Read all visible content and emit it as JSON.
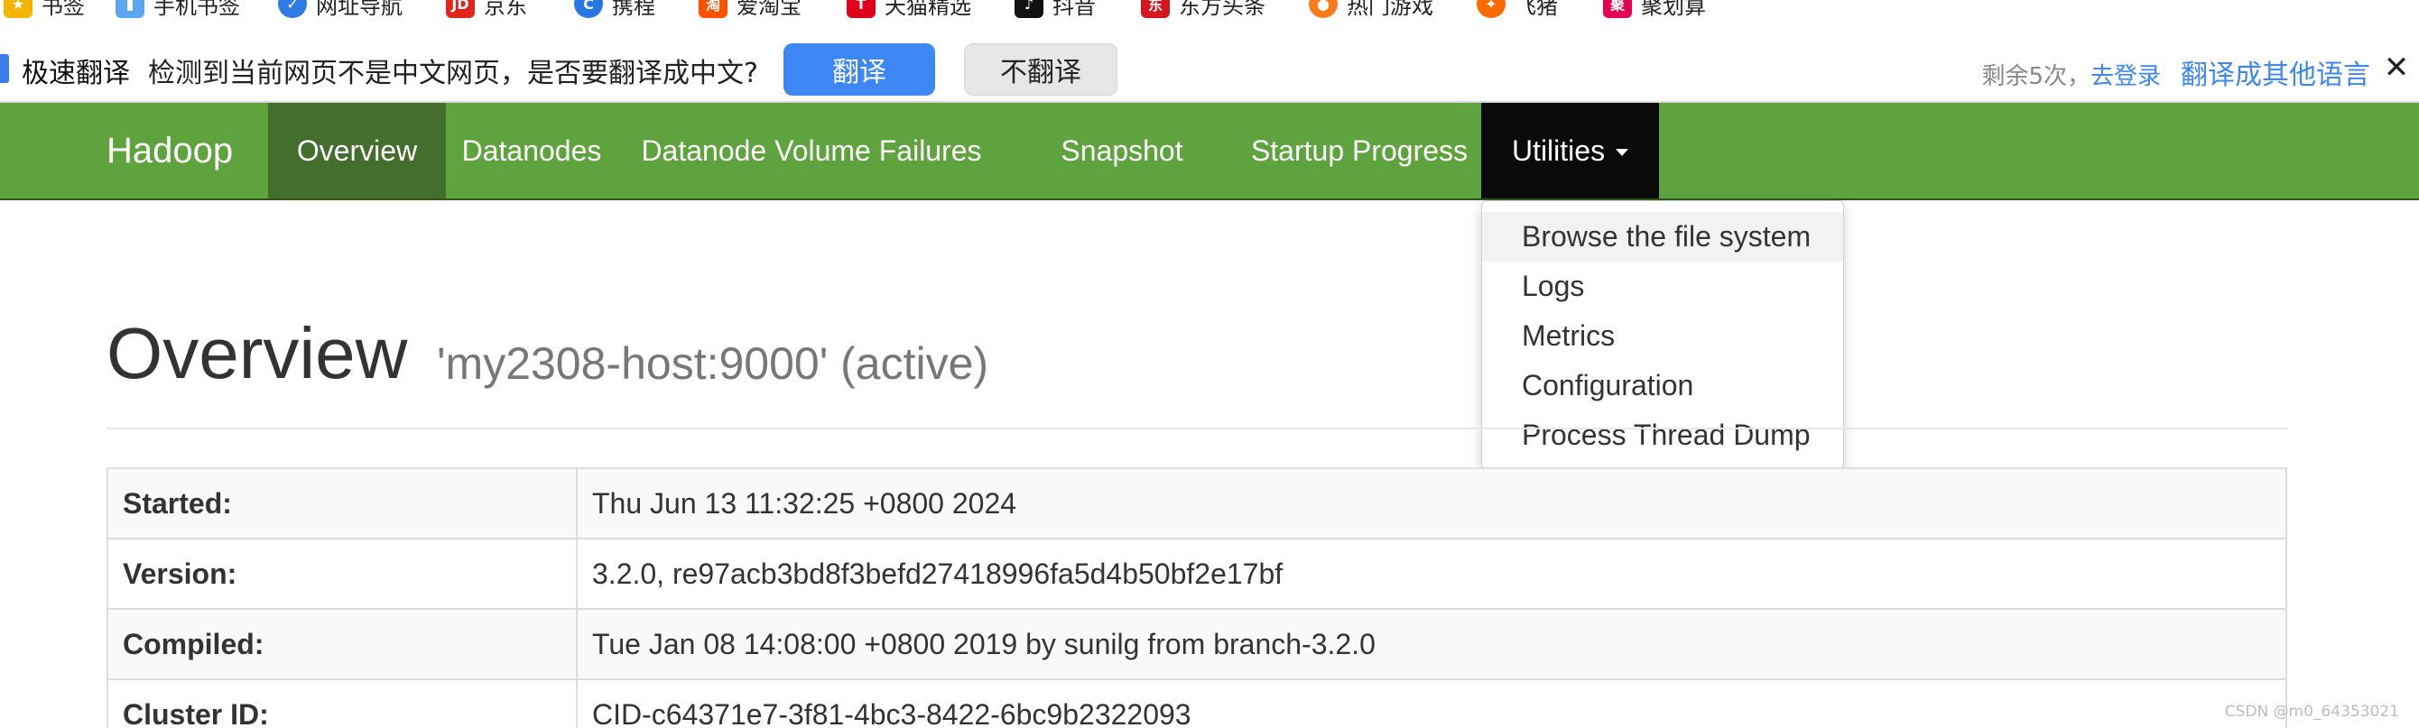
{
  "bookmarks": [
    {
      "label": "书签",
      "icon": "bookmark-star-icon",
      "color": "#f5b400"
    },
    {
      "label": "手机书签",
      "icon": "mobile-bookmark-icon",
      "color": "#5aa7f0"
    },
    {
      "label": "网址导航",
      "icon": "navigation-icon",
      "color": "#2f7be6"
    },
    {
      "label": "京东",
      "icon": "jd-logo-icon",
      "color": "#e1251b"
    },
    {
      "label": "携程",
      "icon": "ctrip-logo-icon",
      "color": "#2577e3"
    },
    {
      "label": "爱淘宝",
      "icon": "aitaobao-logo-icon",
      "color": "#ff5000"
    },
    {
      "label": "天猫精选",
      "icon": "tmall-logo-icon",
      "color": "#e0001b"
    },
    {
      "label": "抖音",
      "icon": "douyin-logo-icon",
      "color": "#111111"
    },
    {
      "label": "东方头条",
      "icon": "dongfang-logo-icon",
      "color": "#d4151b"
    },
    {
      "label": "热门游戏",
      "icon": "game-icon",
      "color": "#ff7a1a"
    },
    {
      "label": "飞猪",
      "icon": "fliggy-logo-icon",
      "color": "#ff6a00"
    },
    {
      "label": "聚划算",
      "icon": "juhuasuan-logo-icon",
      "color": "#e5004f"
    }
  ],
  "translate_bar": {
    "title": "极速翻译",
    "message": "检测到当前网页不是中文网页，是否要翻译成中文?",
    "translate_label": "翻译",
    "no_translate_label": "不翻译",
    "remaining": "剩余5次，",
    "login_label": "去登录",
    "other_lang_label": "翻译成其他语言",
    "close_glyph": "✕"
  },
  "navbar": {
    "brand": "Hadoop",
    "items": [
      {
        "label": "Overview",
        "state": "active"
      },
      {
        "label": "Datanodes",
        "state": "normal"
      },
      {
        "label": "Datanode Volume Failures",
        "state": "normal"
      },
      {
        "label": "Snapshot",
        "state": "normal"
      },
      {
        "label": "Startup Progress",
        "state": "normal"
      },
      {
        "label": "Utilities",
        "state": "open"
      }
    ]
  },
  "utilities_menu": [
    {
      "label": "Browse the file system",
      "hovered": true
    },
    {
      "label": "Logs",
      "hovered": false
    },
    {
      "label": "Metrics",
      "hovered": false
    },
    {
      "label": "Configuration",
      "hovered": false
    },
    {
      "label": "Process Thread Dump",
      "hovered": false
    }
  ],
  "page": {
    "title": "Overview",
    "subtitle": "'my2308-host:9000' (active)"
  },
  "overview_table": [
    {
      "key": "Started:",
      "value": "Thu Jun 13 11:32:25 +0800 2024"
    },
    {
      "key": "Version:",
      "value": "3.2.0, re97acb3bd8f3befd27418996fa5d4b50bf2e17bf"
    },
    {
      "key": "Compiled:",
      "value": "Tue Jan 08 14:08:00 +0800 2019 by sunilg from branch-3.2.0"
    },
    {
      "key": "Cluster ID:",
      "value": "CID-c64371e7-3f81-4bc3-8422-6bc9b2322093"
    }
  ],
  "watermark": "CSDN @m0_64353021",
  "colors": {
    "navbar": "#5fa33e",
    "navbar_active": "#436e2c",
    "navbar_open": "#0a0a0a",
    "translate_button": "#3d87f5",
    "link": "#3d87f5"
  }
}
